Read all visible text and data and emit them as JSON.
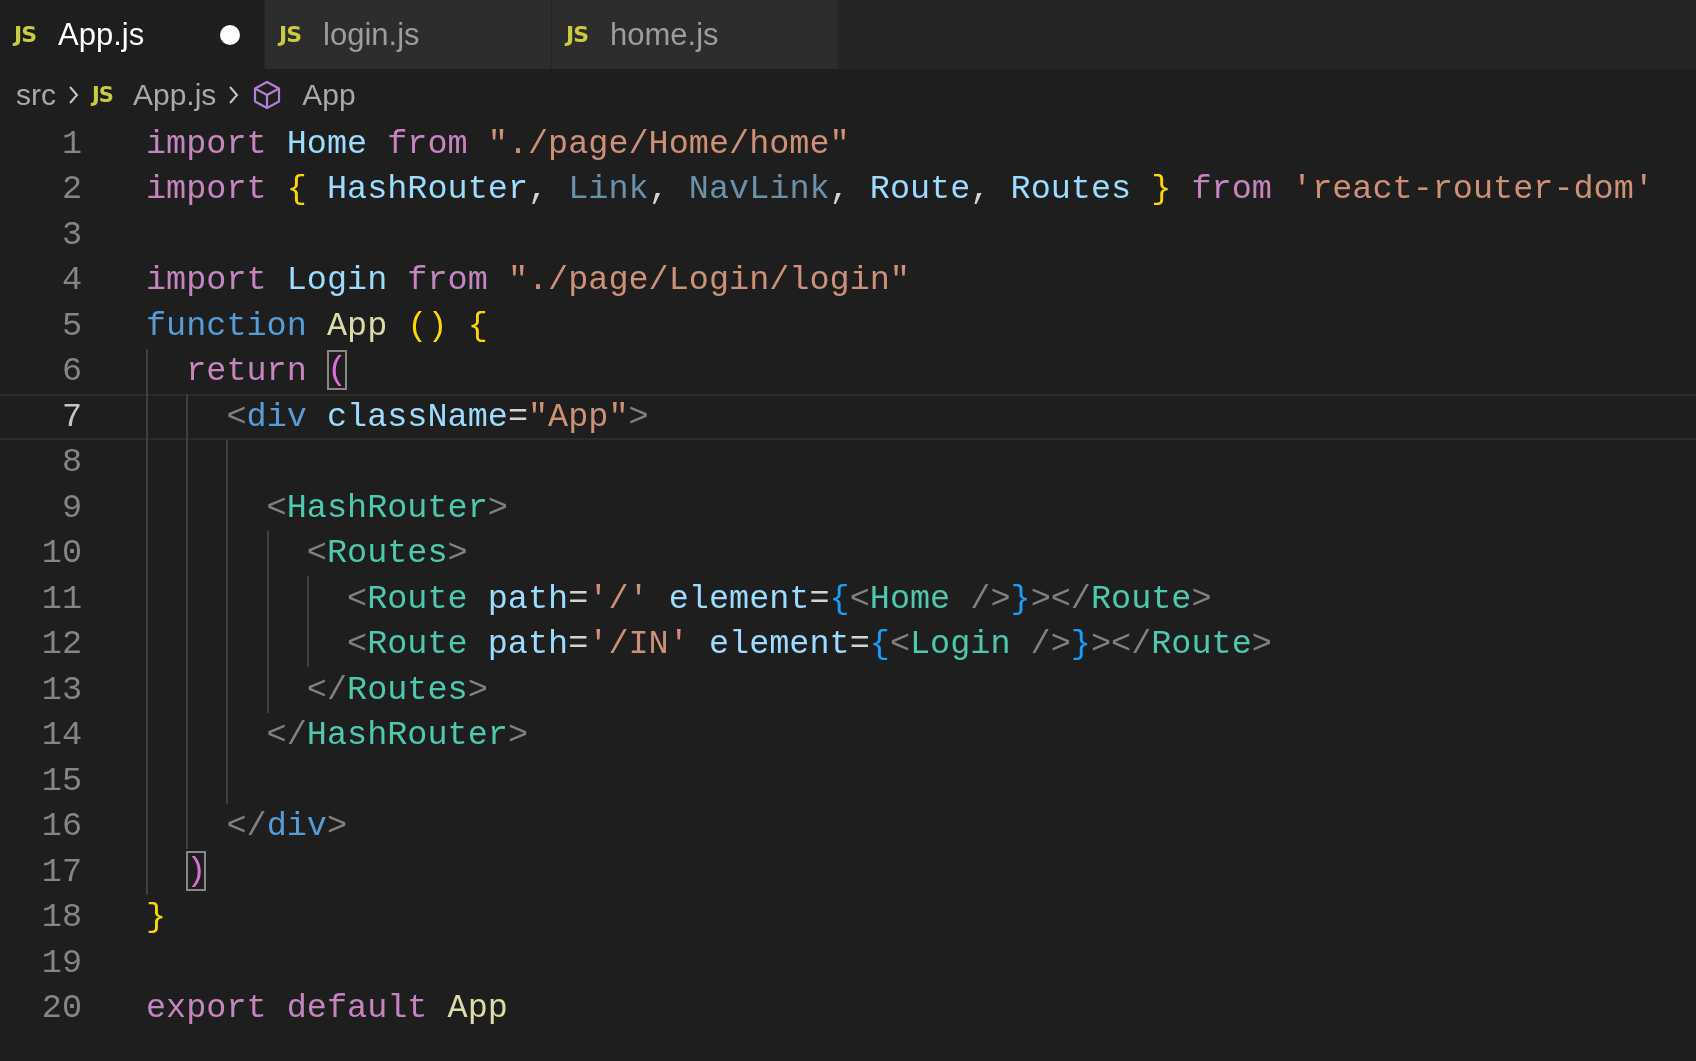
{
  "tabs": [
    {
      "icon": "JS",
      "label": "App.js",
      "selected": true,
      "modified": true
    },
    {
      "icon": "JS",
      "label": "login.js",
      "selected": false,
      "modified": false
    },
    {
      "icon": "JS",
      "label": "home.js",
      "selected": false,
      "modified": false
    }
  ],
  "breadcrumb": [
    {
      "kind": "folder",
      "label": "src"
    },
    {
      "kind": "file",
      "icon": "JS",
      "label": "App.js"
    },
    {
      "kind": "symbol",
      "label": "App"
    }
  ],
  "lines": [
    {
      "number": "1",
      "current": false,
      "tokens": [
        {
          "text": "import ",
          "kind": "keyword"
        },
        {
          "text": "Home ",
          "kind": "variable"
        },
        {
          "text": "from ",
          "kind": "keyword"
        },
        {
          "text": "\"./page/Home/home\"",
          "kind": "string"
        }
      ]
    },
    {
      "number": "2",
      "current": false,
      "tokens": [
        {
          "text": "import ",
          "kind": "keyword"
        },
        {
          "text": "{ ",
          "kind": "brace1"
        },
        {
          "text": "HashRouter",
          "kind": "variable"
        },
        {
          "text": ", ",
          "kind": "plain"
        },
        {
          "text": "Link",
          "kind": "unused"
        },
        {
          "text": ", ",
          "kind": "plain"
        },
        {
          "text": "NavLink",
          "kind": "unused"
        },
        {
          "text": ", ",
          "kind": "plain"
        },
        {
          "text": "Route",
          "kind": "variable"
        },
        {
          "text": ", ",
          "kind": "plain"
        },
        {
          "text": "Routes ",
          "kind": "variable"
        },
        {
          "text": "} ",
          "kind": "brace1"
        },
        {
          "text": "from ",
          "kind": "keyword"
        },
        {
          "text": "'react-router-dom'",
          "kind": "string"
        }
      ]
    },
    {
      "number": "3",
      "current": false
    },
    {
      "number": "4",
      "current": false,
      "tokens": [
        {
          "text": "import ",
          "kind": "keyword"
        },
        {
          "text": "Login ",
          "kind": "variable"
        },
        {
          "text": "from ",
          "kind": "keyword"
        },
        {
          "text": "\"./page/Login/login\"",
          "kind": "string"
        }
      ]
    },
    {
      "number": "5",
      "current": false,
      "tokens": [
        {
          "text": "function ",
          "kind": "storage"
        },
        {
          "text": "App ",
          "kind": "function"
        },
        {
          "text": "() ",
          "kind": "brace1"
        },
        {
          "text": "{",
          "kind": "brace1"
        }
      ]
    },
    {
      "number": "6",
      "current": false,
      "tokens": [
        {
          "text": "  return ",
          "kind": "keyword"
        },
        {
          "text": "(",
          "kind": "brace2",
          "matched": true
        }
      ]
    },
    {
      "number": "7",
      "current": true,
      "tokens": [
        {
          "text": "    <",
          "kind": "tagpunct"
        },
        {
          "text": "div ",
          "kind": "tag"
        },
        {
          "text": "className",
          "kind": "variable"
        },
        {
          "text": "=",
          "kind": "plain"
        },
        {
          "text": "\"App\"",
          "kind": "string"
        },
        {
          "text": ">",
          "kind": "tagpunct"
        }
      ]
    },
    {
      "number": "8",
      "current": false
    },
    {
      "number": "9",
      "current": false,
      "tokens": [
        {
          "text": "      <",
          "kind": "tagpunct"
        },
        {
          "text": "HashRouter",
          "kind": "component"
        },
        {
          "text": ">",
          "kind": "tagpunct"
        }
      ]
    },
    {
      "number": "10",
      "current": false,
      "tokens": [
        {
          "text": "        <",
          "kind": "tagpunct"
        },
        {
          "text": "Routes",
          "kind": "component"
        },
        {
          "text": ">",
          "kind": "tagpunct"
        }
      ]
    },
    {
      "number": "11",
      "current": false,
      "tokens": [
        {
          "text": "          <",
          "kind": "tagpunct"
        },
        {
          "text": "Route ",
          "kind": "component"
        },
        {
          "text": "path",
          "kind": "variable"
        },
        {
          "text": "=",
          "kind": "plain"
        },
        {
          "text": "'/' ",
          "kind": "string"
        },
        {
          "text": "element",
          "kind": "variable"
        },
        {
          "text": "=",
          "kind": "plain"
        },
        {
          "text": "{",
          "kind": "brace3"
        },
        {
          "text": "<",
          "kind": "tagpunct"
        },
        {
          "text": "Home ",
          "kind": "component"
        },
        {
          "text": "/>",
          "kind": "tagpunct"
        },
        {
          "text": "}",
          "kind": "brace3"
        },
        {
          "text": "></",
          "kind": "tagpunct"
        },
        {
          "text": "Route",
          "kind": "component"
        },
        {
          "text": ">",
          "kind": "tagpunct"
        }
      ]
    },
    {
      "number": "12",
      "current": false,
      "tokens": [
        {
          "text": "          <",
          "kind": "tagpunct"
        },
        {
          "text": "Route ",
          "kind": "component"
        },
        {
          "text": "path",
          "kind": "variable"
        },
        {
          "text": "=",
          "kind": "plain"
        },
        {
          "text": "'/IN' ",
          "kind": "string"
        },
        {
          "text": "element",
          "kind": "variable"
        },
        {
          "text": "=",
          "kind": "plain"
        },
        {
          "text": "{",
          "kind": "brace3"
        },
        {
          "text": "<",
          "kind": "tagpunct"
        },
        {
          "text": "Login ",
          "kind": "component"
        },
        {
          "text": "/>",
          "kind": "tagpunct"
        },
        {
          "text": "}",
          "kind": "brace3"
        },
        {
          "text": "></",
          "kind": "tagpunct"
        },
        {
          "text": "Route",
          "kind": "component"
        },
        {
          "text": ">",
          "kind": "tagpunct"
        }
      ]
    },
    {
      "number": "13",
      "current": false,
      "tokens": [
        {
          "text": "        </",
          "kind": "tagpunct"
        },
        {
          "text": "Routes",
          "kind": "component"
        },
        {
          "text": ">",
          "kind": "tagpunct"
        }
      ]
    },
    {
      "number": "14",
      "current": false,
      "tokens": [
        {
          "text": "      </",
          "kind": "tagpunct"
        },
        {
          "text": "HashRouter",
          "kind": "component"
        },
        {
          "text": ">",
          "kind": "tagpunct"
        }
      ]
    },
    {
      "number": "15",
      "current": false
    },
    {
      "number": "16",
      "current": false,
      "tokens": [
        {
          "text": "    </",
          "kind": "tagpunct"
        },
        {
          "text": "div",
          "kind": "tag"
        },
        {
          "text": ">",
          "kind": "tagpunct"
        }
      ]
    },
    {
      "number": "17",
      "current": false,
      "tokens": [
        {
          "text": "  )",
          "kind": "brace2",
          "matched": true
        }
      ]
    },
    {
      "number": "18",
      "current": false,
      "tokens": [
        {
          "text": "}",
          "kind": "brace1"
        }
      ]
    },
    {
      "number": "19",
      "current": false
    },
    {
      "number": "20",
      "current": false,
      "tokens": [
        {
          "text": "export ",
          "kind": "keyword"
        },
        {
          "text": "default ",
          "kind": "keyword"
        },
        {
          "text": "App",
          "kind": "function"
        }
      ]
    }
  ]
}
